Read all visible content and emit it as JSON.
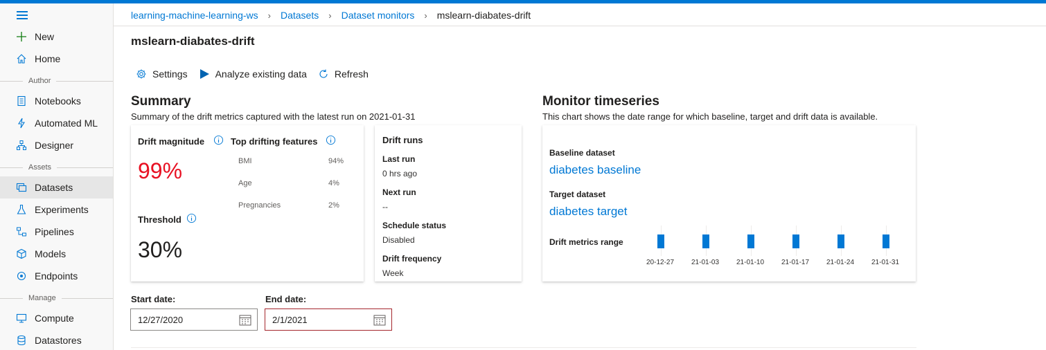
{
  "colors": {
    "accent": "#0078d4",
    "alert": "#e81123"
  },
  "sidebar": {
    "items": [
      {
        "label": "New",
        "icon": "plus-icon"
      },
      {
        "label": "Home",
        "icon": "home-icon"
      },
      {
        "label": "Notebooks",
        "icon": "notebook-icon"
      },
      {
        "label": "Automated ML",
        "icon": "automl-icon"
      },
      {
        "label": "Designer",
        "icon": "designer-icon"
      },
      {
        "label": "Datasets",
        "icon": "dataset-icon"
      },
      {
        "label": "Experiments",
        "icon": "flask-icon"
      },
      {
        "label": "Pipelines",
        "icon": "pipeline-icon"
      },
      {
        "label": "Models",
        "icon": "cube-icon"
      },
      {
        "label": "Endpoints",
        "icon": "endpoint-icon"
      },
      {
        "label": "Compute",
        "icon": "compute-icon"
      },
      {
        "label": "Datastores",
        "icon": "database-icon"
      }
    ],
    "sections": {
      "author": "Author",
      "assets": "Assets",
      "manage": "Manage"
    }
  },
  "breadcrumb": {
    "workspace": "learning-machine-learning-ws",
    "datasets": "Datasets",
    "monitors": "Dataset monitors",
    "current": "mslearn-diabates-drift"
  },
  "page": {
    "title": "mslearn-diabates-drift"
  },
  "toolbar": {
    "settings": "Settings",
    "analyze": "Analyze existing data",
    "refresh": "Refresh"
  },
  "summary": {
    "title": "Summary",
    "subtitle": "Summary of the drift metrics captured with the latest run on 2021-01-31",
    "drift_magnitude_label": "Drift magnitude",
    "drift_magnitude_value": "99%",
    "threshold_label": "Threshold",
    "threshold_value": "30%",
    "top_features_label": "Top drifting features",
    "features": [
      {
        "name": "BMI",
        "value": "94%"
      },
      {
        "name": "Age",
        "value": "4%"
      },
      {
        "name": "Pregnancies",
        "value": "2%"
      }
    ]
  },
  "drift_runs": {
    "title": "Drift runs",
    "last_run_label": "Last run",
    "last_run_value": "0 hrs ago",
    "next_run_label": "Next run",
    "next_run_value": "--",
    "schedule_label": "Schedule status",
    "schedule_value": "Disabled",
    "frequency_label": "Drift frequency",
    "frequency_value": "Week"
  },
  "monitor": {
    "title": "Monitor timeseries",
    "subtitle": "This chart shows the date range for which baseline, target and drift data is available.",
    "baseline_label": "Baseline dataset",
    "baseline_value": "diabetes baseline",
    "target_label": "Target dataset",
    "target_value": "diabetes target",
    "drift_range_label": "Drift metrics range",
    "ticks": [
      "20-12-27",
      "21-01-03",
      "21-01-10",
      "21-01-17",
      "21-01-24",
      "21-01-31"
    ]
  },
  "dates": {
    "start_label": "Start date:",
    "start_value": "12/27/2020",
    "end_label": "End date:",
    "end_value": "2/1/2021"
  }
}
